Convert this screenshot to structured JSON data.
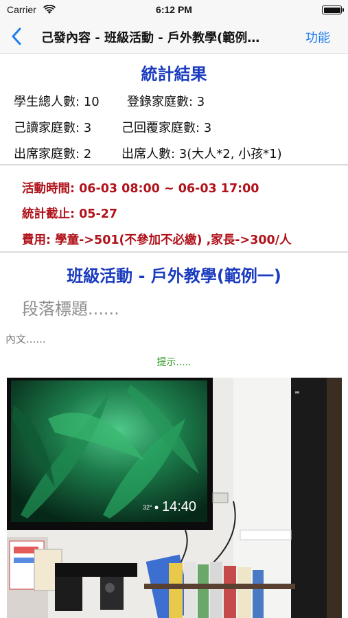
{
  "status_bar": {
    "carrier": "Carrier",
    "time": "6:12 PM"
  },
  "nav": {
    "title": "己發內容 - 班級活動 - 戶外教學(範例…",
    "function_label": "功能"
  },
  "stats": {
    "title": "統計結果",
    "total_students": "學生總人數: 10",
    "registered_families": "登錄家庭數: 3",
    "read_families": "己讀家庭數: 3",
    "replied_families": "己回覆家庭數: 3",
    "attending_families": "出席家庭數: 2",
    "attendees": "出席人數: 3(大人*2, 小孩*1)"
  },
  "event": {
    "time": "活動時間: 06-03  08:00 ~ 06-03  17:00",
    "deadline": "統計截止: 05-27",
    "fee": "費用: 學童->501(不參加不必繳) ,家長->300/人"
  },
  "content": {
    "title": "班級活動 - 戶外教學(範例一)",
    "paragraph_title": "段落標題......",
    "body": "內文......",
    "hint": "提示....."
  },
  "photo": {
    "tv_clock": "14:40",
    "tv_temp": "32°"
  },
  "colors": {
    "accent_blue": "#1a3bbf",
    "link_blue": "#1e7cf0",
    "warning_red": "#b0121a",
    "hint_green": "#2e9b22"
  }
}
